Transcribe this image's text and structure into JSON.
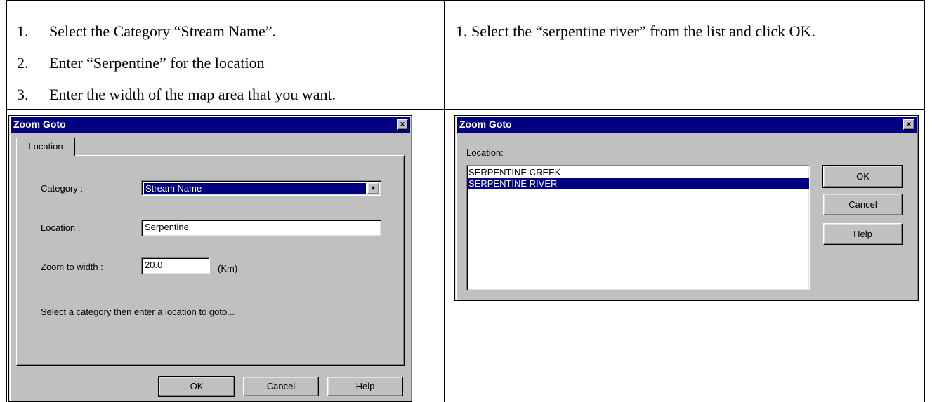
{
  "left_instructions": [
    {
      "number": "1.",
      "text": "Select the Category “Stream Name”."
    },
    {
      "number": "2.",
      "text": "Enter “Serpentine” for the location"
    },
    {
      "number": "3.",
      "text": "Enter the width of the map area that you want."
    }
  ],
  "right_instructions": [
    {
      "text": "1. Select the “serpentine river” from the list and click OK."
    }
  ],
  "dialog_left": {
    "title": "Zoom Goto",
    "close_glyph": "×",
    "tab_label": "Location",
    "category_label": "Category :",
    "category_value": "Stream Name",
    "location_label": "Location :",
    "location_value": "Serpentine",
    "zoom_label": "Zoom to width :",
    "zoom_value": "20.0",
    "zoom_unit": "(Km)",
    "hint": "Select a category then enter a location to goto...",
    "ok_label": "OK",
    "cancel_label": "Cancel",
    "help_label": "Help"
  },
  "dialog_right": {
    "title": "Zoom Goto",
    "close_glyph": "×",
    "location_label": "Location:",
    "list_items": [
      "SERPENTINE CREEK",
      "SERPENTINE RIVER"
    ],
    "selected_index": 1,
    "ok_label": "OK",
    "cancel_label": "Cancel",
    "help_label": "Help"
  },
  "colors": {
    "title_bar": "#000080",
    "dialog_face": "#c0c0c0",
    "selection": "#000080"
  }
}
